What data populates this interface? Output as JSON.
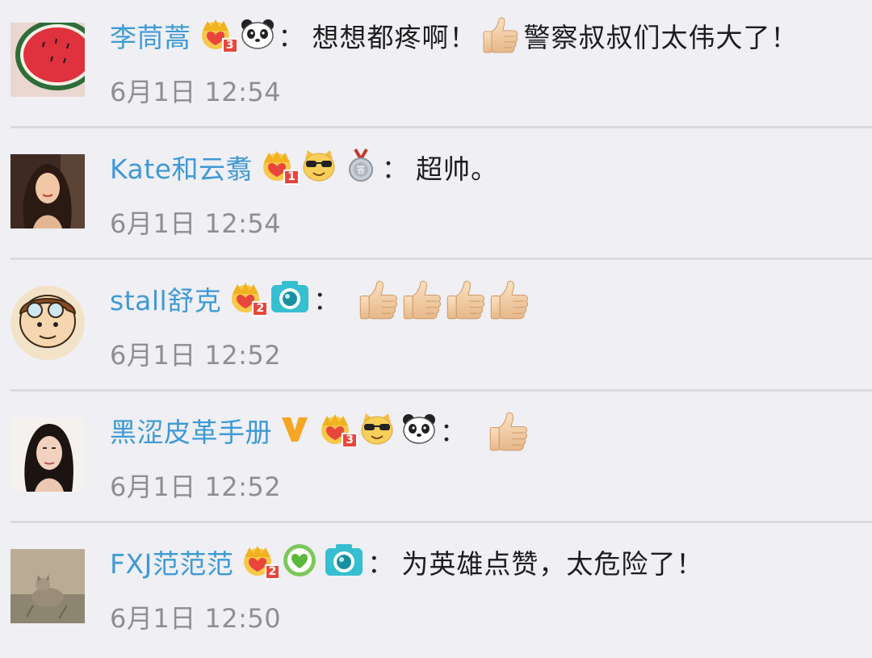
{
  "comments": [
    {
      "username": "李茼蒿",
      "level": "3",
      "text_before": "想想都疼啊！",
      "text_after": "警察叔叔们太伟大了！",
      "time": "6月1日 12:54",
      "badges": [
        "crown-icon",
        "panda-icon"
      ]
    },
    {
      "username": "Kate和云翥",
      "level": "1",
      "text_before": "超帅。",
      "text_after": "",
      "time": "6月1日 12:54",
      "badges": [
        "crown-icon",
        "cool-cat-icon",
        "medal-icon"
      ]
    },
    {
      "username": "stall舒克",
      "level": "2",
      "text_before": "",
      "text_after": "",
      "time": "6月1日 12:52",
      "badges": [
        "crown-icon",
        "camera-icon"
      ],
      "thumbs": 4
    },
    {
      "username": "黑涩皮革手册",
      "level": "3",
      "text_before": "",
      "text_after": "",
      "time": "6月1日 12:52",
      "badges": [
        "verified-v-icon",
        "crown-icon",
        "cool-cat-icon",
        "panda-icon"
      ],
      "thumbs": 1
    },
    {
      "username": "FXJ范范范",
      "level": "2",
      "text_before": "为英雄点赞，太危险了！",
      "text_after": "",
      "time": "6月1日 12:50",
      "badges": [
        "crown-icon",
        "heart-circle-icon",
        "camera-icon"
      ]
    }
  ],
  "colon": "：",
  "colors": {
    "username": "#3f9ad4",
    "time": "#8e8e93",
    "background": "#efeff4",
    "divider": "#d9d9de",
    "crown": "#f2b11e",
    "level": "#e8463c"
  }
}
